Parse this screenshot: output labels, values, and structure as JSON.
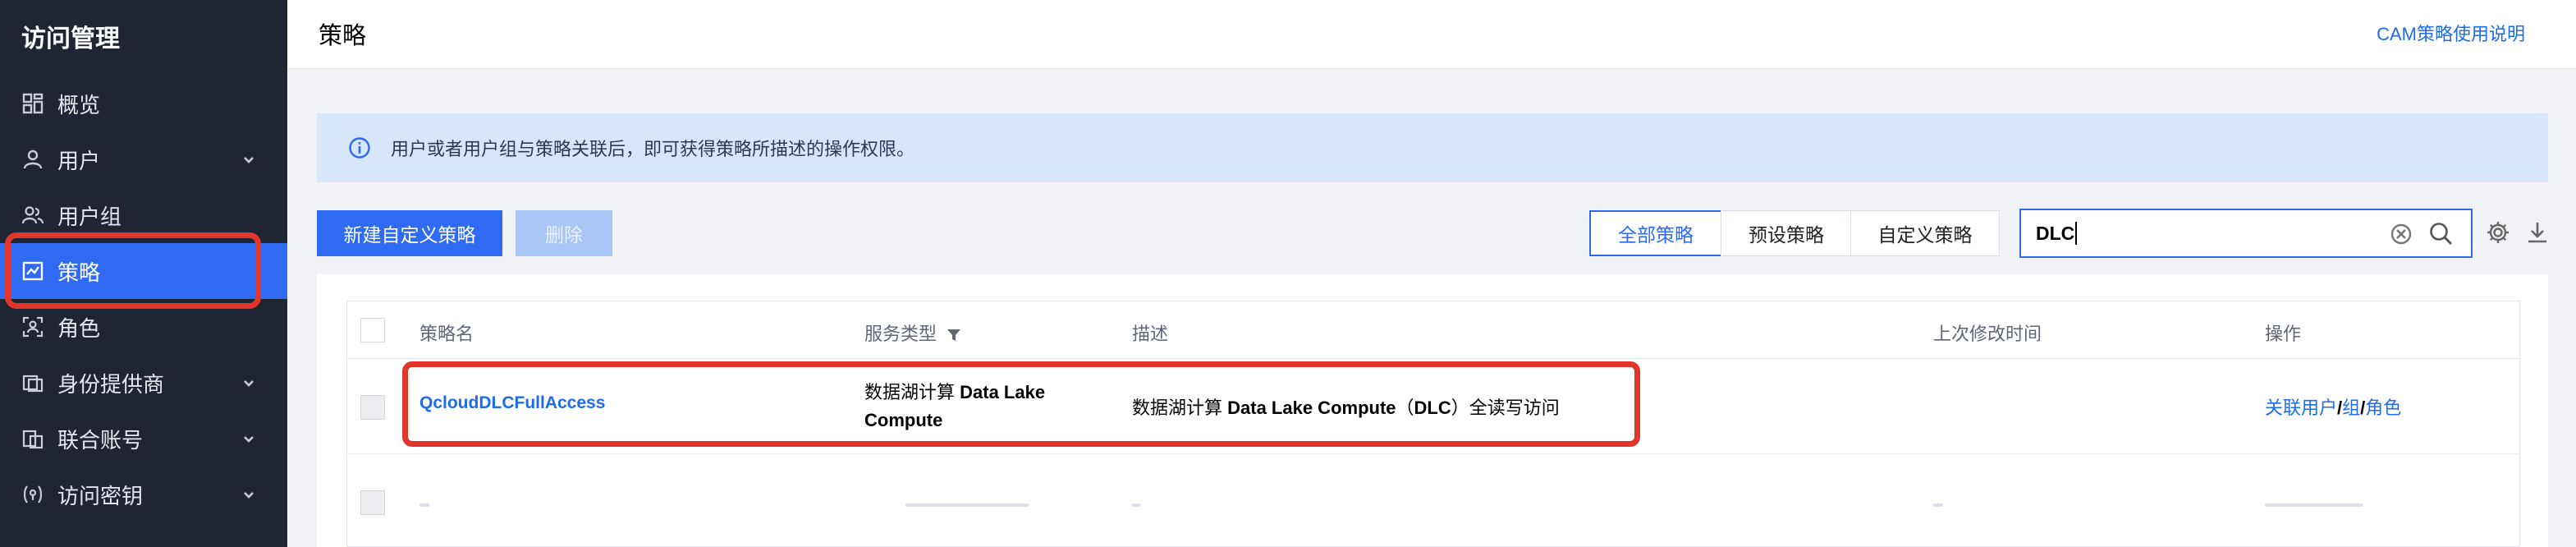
{
  "app": {
    "title": "访问管理"
  },
  "sidebar": {
    "items": [
      {
        "label": "概览",
        "icon": "dashboard-icon",
        "expandable": false,
        "active": false
      },
      {
        "label": "用户",
        "icon": "user-icon",
        "expandable": true,
        "active": false
      },
      {
        "label": "用户组",
        "icon": "user-group-icon",
        "expandable": false,
        "active": false
      },
      {
        "label": "策略",
        "icon": "policy-icon",
        "expandable": false,
        "active": true
      },
      {
        "label": "角色",
        "icon": "role-icon",
        "expandable": false,
        "active": false
      },
      {
        "label": "身份提供商",
        "icon": "identity-provider-icon",
        "expandable": true,
        "active": false
      },
      {
        "label": "联合账号",
        "icon": "federated-account-icon",
        "expandable": true,
        "active": false
      },
      {
        "label": "访问密钥",
        "icon": "access-key-icon",
        "expandable": true,
        "active": false
      }
    ]
  },
  "header": {
    "title": "策略",
    "help_link": "CAM策略使用说明"
  },
  "info": {
    "text": "用户或者用户组与策略关联后，即可获得策略所描述的操作权限。"
  },
  "toolbar": {
    "create_label": "新建自定义策略",
    "delete_label": "删除",
    "tabs": [
      {
        "label": "全部策略",
        "active": true
      },
      {
        "label": "预设策略",
        "active": false
      },
      {
        "label": "自定义策略",
        "active": false
      }
    ],
    "search_value": "DLC"
  },
  "table": {
    "columns": [
      "策略名",
      "服务类型",
      "描述",
      "上次修改时间",
      "操作"
    ],
    "rows": [
      {
        "name": "QcloudDLCFullAccess",
        "service_prefix": "数据湖计算 ",
        "service_bold_1": "Data Lake",
        "service_bold_2": "Compute",
        "desc_prefix": "数据湖计算 ",
        "desc_bold": "Data Lake Compute",
        "desc_mid": "（",
        "desc_bold2": "DLC",
        "desc_suffix": "）全读写访问",
        "modified": "",
        "action_1": "关联用户",
        "action_sep_1": "/",
        "action_2": "组",
        "action_sep_2": "/",
        "action_3": "角色"
      }
    ]
  },
  "colors": {
    "accent": "#2f6bf2",
    "sidebar_bg": "#1f2532",
    "highlight": "#e2362c",
    "banner": "#d6e6fb"
  }
}
